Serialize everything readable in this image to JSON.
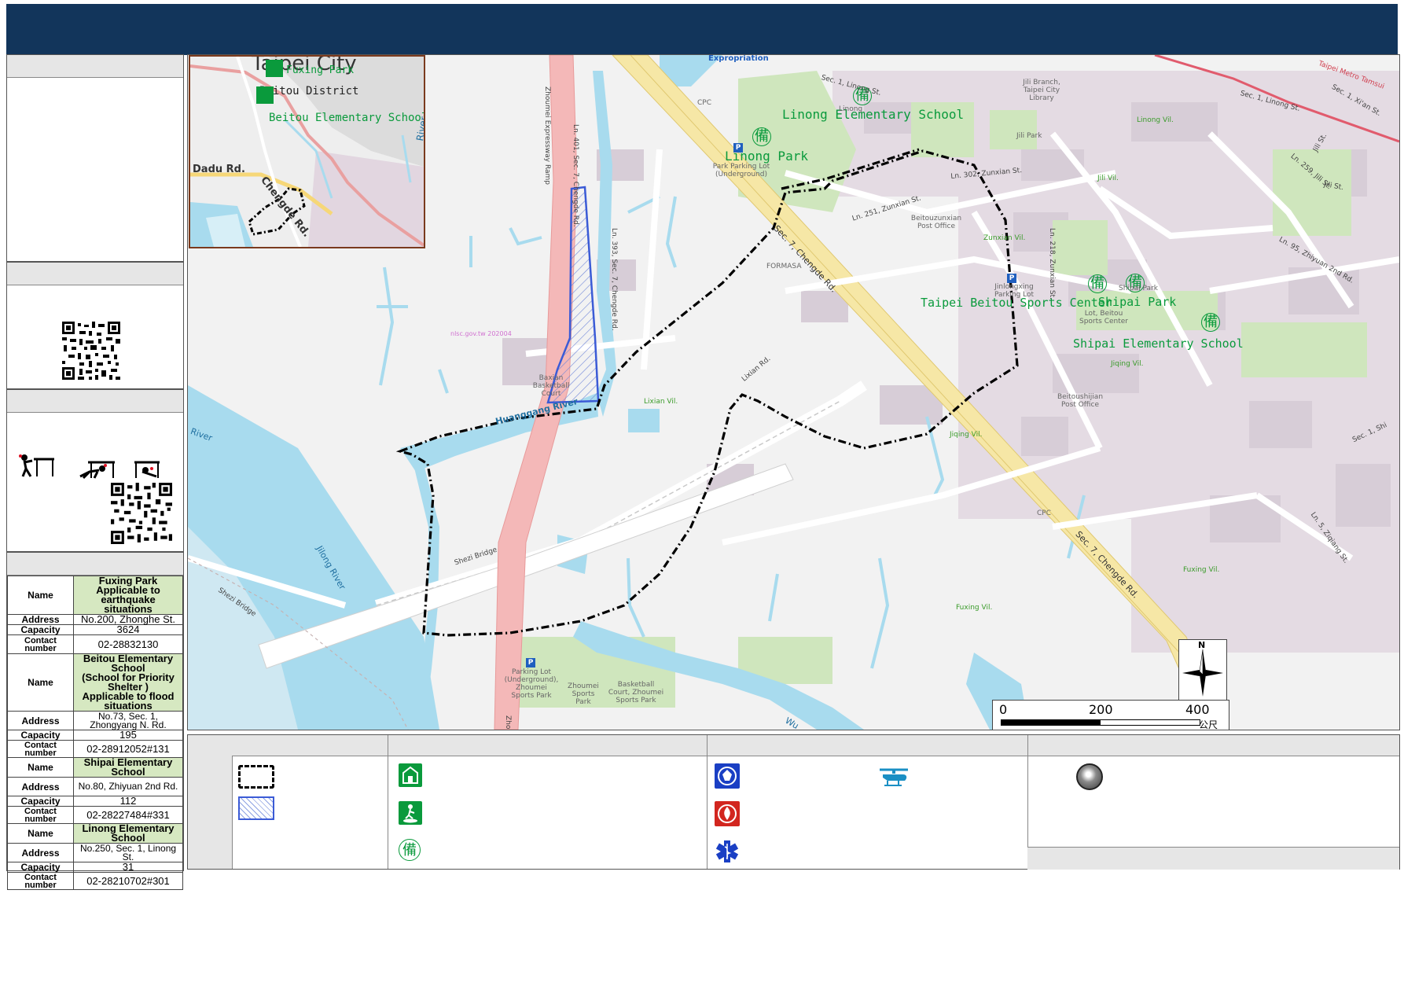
{
  "map": {
    "inset_labels": {
      "city": "Taipei City",
      "district": "Beitou District",
      "road1": "Dadu Rd.",
      "road2": "Chengde Rd.",
      "poi1": "Fuxing Park",
      "poi2": "Beitou Elementary School",
      "river": "River"
    },
    "roads": [
      "Zhoumei Expressway Ramp",
      "Ln. 401, Sec. 7, Chengde Rd.",
      "Ln. 393, Sec. 7, Chengde Rd.",
      "Sec. 7, Chengde Rd.",
      "Sec. 7, Chengde Rd.",
      "Lixian Rd.",
      "Shezi Bridge",
      "Shezi Bridge",
      "Ln. 302, Zunxian St.",
      "Ln. 251, Zunxian St.",
      "Ln. 218, Zunxian St.",
      "Sec. 1, Linong St.",
      "Sec. 1, Linong St.",
      "Jili St.",
      "Ln. 259, Jili St.",
      "Jili St.",
      "Ln. 95, Zhiyuan 2nd Rd.",
      "Sec. 1, Xi'an St.",
      "Ln. 5, Ziqiang St.",
      "Sec. 1, Shi",
      "Taipei Metro Tamsui",
      "Zho"
    ],
    "rivers": [
      "Huanggang River",
      "Jilong River",
      "River",
      "Wu"
    ],
    "villages": [
      "Lixian Vil.",
      "Zunxian Vil.",
      "Jili Vil.",
      "Linong Vil.",
      "Jiqing Vil.",
      "Jiqing Vil.",
      "Fuxing Vil.",
      "Fuxing Vil."
    ],
    "shelters": [
      "Linong Elementary School",
      "Linong Park",
      "Taipei Beitou Sports Center",
      "Shipai Park",
      "Shipai Elementary School"
    ],
    "pois": [
      "CPC",
      "CPC",
      "FORMASA",
      "Expropriation",
      "Jili Branch, Taipei City Library",
      "Linong",
      "Jili Park",
      "Park Parking Lot (Underground)",
      "Beitouzunxian Post Office",
      "Jinlongxing Parking Lot",
      "Lot, Beitou Sports Center",
      "Shipai Park",
      "Beitoushijian Post Office",
      "Baxian Basketball Court",
      "Parking Lot (Underground), Zhoumei Sports Park",
      "Zhoumei Sports Park",
      "Basketball Court, Zhoumei Sports Park",
      "nlsc.gov.tw 202004"
    ],
    "compass": "N",
    "scale": {
      "t0": "0",
      "t1": "200",
      "t2": "400",
      "unit": "公尺"
    }
  },
  "shelters_table": [
    {
      "name": "Fuxing Park\nApplicable to earthquake situations",
      "address": "No.200, Zhonghe St.",
      "capacity": "3624",
      "contact": "02-28832130"
    },
    {
      "name": "Beitou Elementary School\n(School for Priority Shelter )\nApplicable to flood situations",
      "address": "No.73, Sec. 1, Zhongyang N. Rd.",
      "capacity": "195",
      "contact": "02-28912052#131"
    },
    {
      "name": "Shipai Elementary School",
      "address": "No.80, Zhiyuan 2nd Rd.",
      "capacity": "112",
      "contact": "02-28227484#331"
    },
    {
      "name": "Linong Elementary School",
      "address": "No.250, Sec. 1, Linong St.",
      "capacity": "31",
      "contact": "02-28210702#301"
    }
  ],
  "table_keys": {
    "name": "Name",
    "address": "Address",
    "capacity": "Capacity",
    "contact": "Contact number"
  },
  "legend": {
    "shelter_symbol": "備"
  },
  "colors": {
    "header": "#12355b",
    "water": "#a8dbee",
    "green": "#cde6bc",
    "road_yellow": "#f6e7a6",
    "ramp_pink": "#f4b8b8",
    "shelter_green": "#0a9a3c",
    "boundary": "#000000",
    "hatch": "#3b5bd6"
  }
}
